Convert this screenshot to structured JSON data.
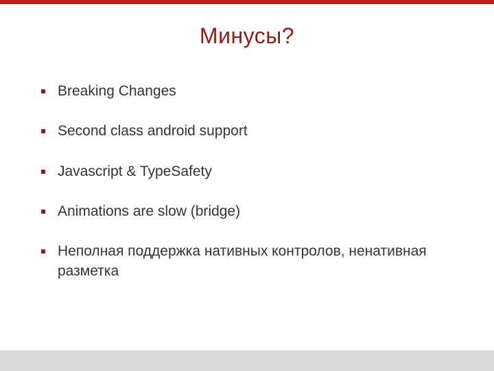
{
  "colors": {
    "accent": "#b02319",
    "title": "#8b1e17",
    "text": "#333333",
    "footer": "#d9d9d9"
  },
  "slide": {
    "title": "Минусы?",
    "bullets": [
      "Breaking Changes",
      "Second class android support",
      "Javascript & TypeSafety",
      "Animations are slow (bridge)",
      "Неполная поддержка нативных контролов, ненативная разметка"
    ]
  }
}
